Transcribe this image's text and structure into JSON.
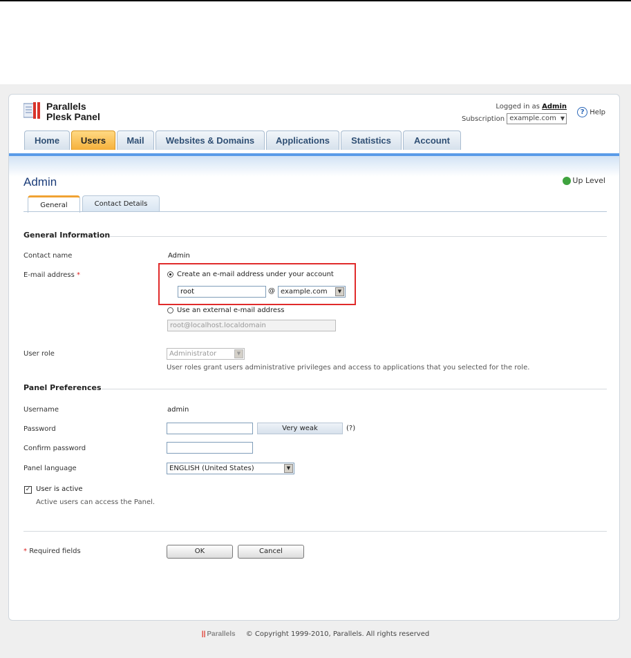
{
  "app": {
    "logo_line1": "Parallels",
    "logo_line2": "Plesk Panel",
    "logged_in_prefix": "Logged in as",
    "logged_in_user": "Admin",
    "subscription_label": "Subscription",
    "subscription_value": "example.com",
    "help_label": "Help"
  },
  "nav": {
    "tabs": [
      {
        "label": "Home"
      },
      {
        "label": "Users"
      },
      {
        "label": "Mail"
      },
      {
        "label": "Websites & Domains"
      },
      {
        "label": "Applications"
      },
      {
        "label": "Statistics"
      },
      {
        "label": "Account"
      }
    ],
    "active": "Users"
  },
  "page": {
    "title": "Admin",
    "up_level": "Up Level",
    "subtabs": [
      {
        "label": "General"
      },
      {
        "label": "Contact Details"
      }
    ]
  },
  "general": {
    "section_title": "General Information",
    "contact_name_label": "Contact name",
    "contact_name_value": "Admin",
    "email_label": "E-mail address",
    "required_star": "*",
    "create_option": "Create an e-mail address under your account",
    "mailbox_value": "root",
    "at_sign": "@",
    "domain_value": "example.com",
    "external_option": "Use an external e-mail address",
    "external_value": "root@localhost.localdomain",
    "role_label": "User role",
    "role_value": "Administrator",
    "role_hint": "User roles grant users administrative privileges and access to applications that you selected for the role."
  },
  "prefs": {
    "section_title": "Panel Preferences",
    "username_label": "Username",
    "username_value": "admin",
    "password_label": "Password",
    "password_value": "",
    "strength_text": "Very weak",
    "strength_help": "(?)",
    "confirm_label": "Confirm password",
    "confirm_value": "",
    "language_label": "Panel language",
    "language_value": "ENGLISH (United States)",
    "active_label": "User is active",
    "active_hint": "Active users can access the Panel."
  },
  "form": {
    "required_star": "*",
    "required_note": "Required fields",
    "ok_label": "OK",
    "cancel_label": "Cancel"
  },
  "footer": {
    "brand": "Parallels",
    "copyright": "© Copyright 1999-2010, Parallels. All rights reserved"
  },
  "colors": {
    "active_tab": "#f6b13b",
    "tab_bar": "#5a9be8",
    "title": "#1a3c79",
    "highlight_frame": "#e02a2a"
  }
}
